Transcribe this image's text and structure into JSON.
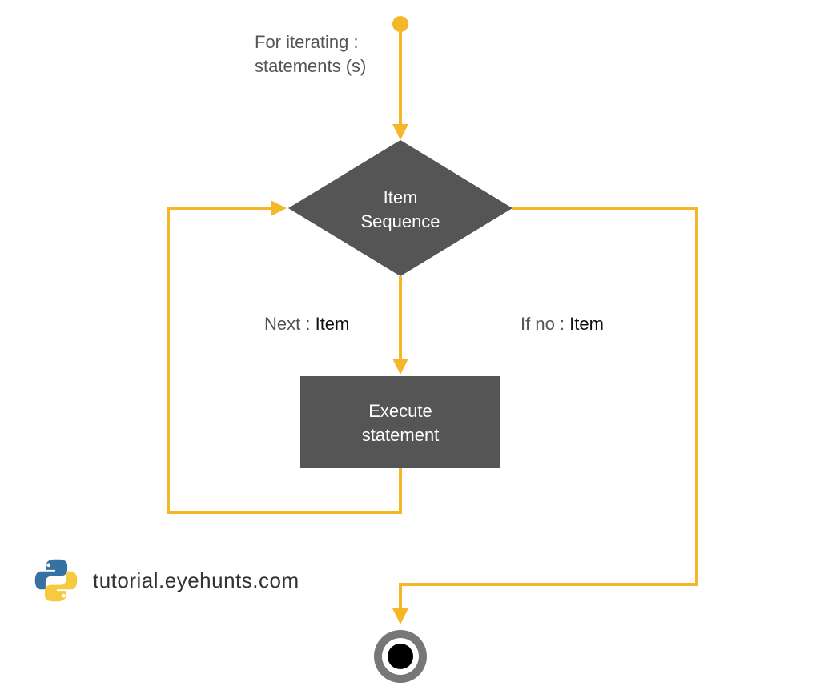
{
  "diagram": {
    "title_line1": "For iterating :",
    "title_line2": "statements (s)",
    "decision_line1": "Item",
    "decision_line2": "Sequence",
    "process_line1": "Execute",
    "process_line2": "statement",
    "label_next_prefix": "Next : ",
    "label_next_strong": "Item",
    "label_ifno_prefix": "If no : ",
    "label_ifno_strong": "Item"
  },
  "footer": {
    "text": "tutorial.eyehunts.com"
  }
}
